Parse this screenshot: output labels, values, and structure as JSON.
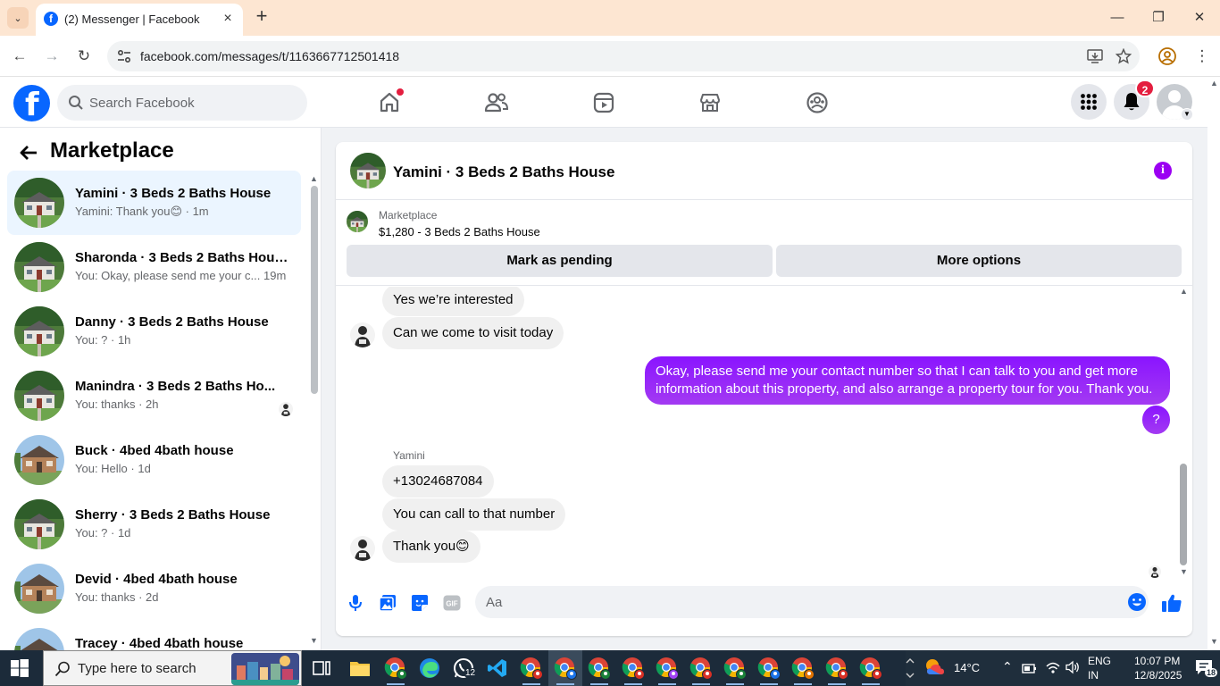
{
  "browser": {
    "tab_title": "(2) Messenger | Facebook",
    "url": "facebook.com/messages/t/1163667712501418"
  },
  "fb": {
    "search_placeholder": "Search Facebook",
    "notification_count": "2"
  },
  "sidebar": {
    "title": "Marketplace",
    "conversations": [
      {
        "name": "Yamini · 3 Beds 2 Baths House",
        "preview": "Yamini: Thank you😊 · 1m",
        "active": true,
        "house": "green"
      },
      {
        "name": "Sharonda · 3 Beds 2 Baths House",
        "preview": "You: Okay, please send me your c...  19m",
        "house": "green"
      },
      {
        "name": "Danny · 3 Beds 2 Baths House",
        "preview": "You: ? · 1h",
        "house": "green"
      },
      {
        "name": "Manindra · 3 Beds 2 Baths Ho...",
        "preview": "You: thanks · 2h",
        "house": "green",
        "seen": true
      },
      {
        "name": "Buck · 4bed 4bath house",
        "preview": "You: Hello · 1d",
        "house": "brick"
      },
      {
        "name": "Sherry · 3 Beds 2 Baths House",
        "preview": "You: ? · 1d",
        "house": "green"
      },
      {
        "name": "Devid · 4bed 4bath house",
        "preview": "You: thanks · 2d",
        "house": "brick"
      },
      {
        "name": "Tracey · 4bed 4bath house",
        "preview": "",
        "house": "brick"
      }
    ]
  },
  "chat": {
    "title": "Yamini · 3 Beds 2 Baths House",
    "listing_category": "Marketplace",
    "listing_price": "$1,280 - 3 Beds 2 Baths House",
    "mark_pending": "Mark as pending",
    "more_options": "More options",
    "messages": {
      "m1": "Yes we’re interested",
      "m2": "Can we come to visit today",
      "m3": "Okay, please send me your contact number so that I can talk to you and get more information about this property, and also arrange a property tour for you. Thank you.",
      "m4": "?",
      "sender": "Yamini",
      "m5": "+13024687084",
      "m6": "You can call to that number",
      "m7": "Thank you😊"
    },
    "composer_placeholder": "Aa"
  },
  "taskbar": {
    "search_text": "Type here to search",
    "weather": "14°C",
    "lang1": "ENG",
    "lang2": "IN",
    "time": "10:07 PM",
    "date": "12/8/2025",
    "whatsapp_badge": "12",
    "notif_count": "18"
  },
  "colors": {
    "fb_blue": "#0866ff",
    "bubble_me": "#8a14ff",
    "bubble_them": "#f0f0f0",
    "active_conv": "#ebf5ff"
  }
}
